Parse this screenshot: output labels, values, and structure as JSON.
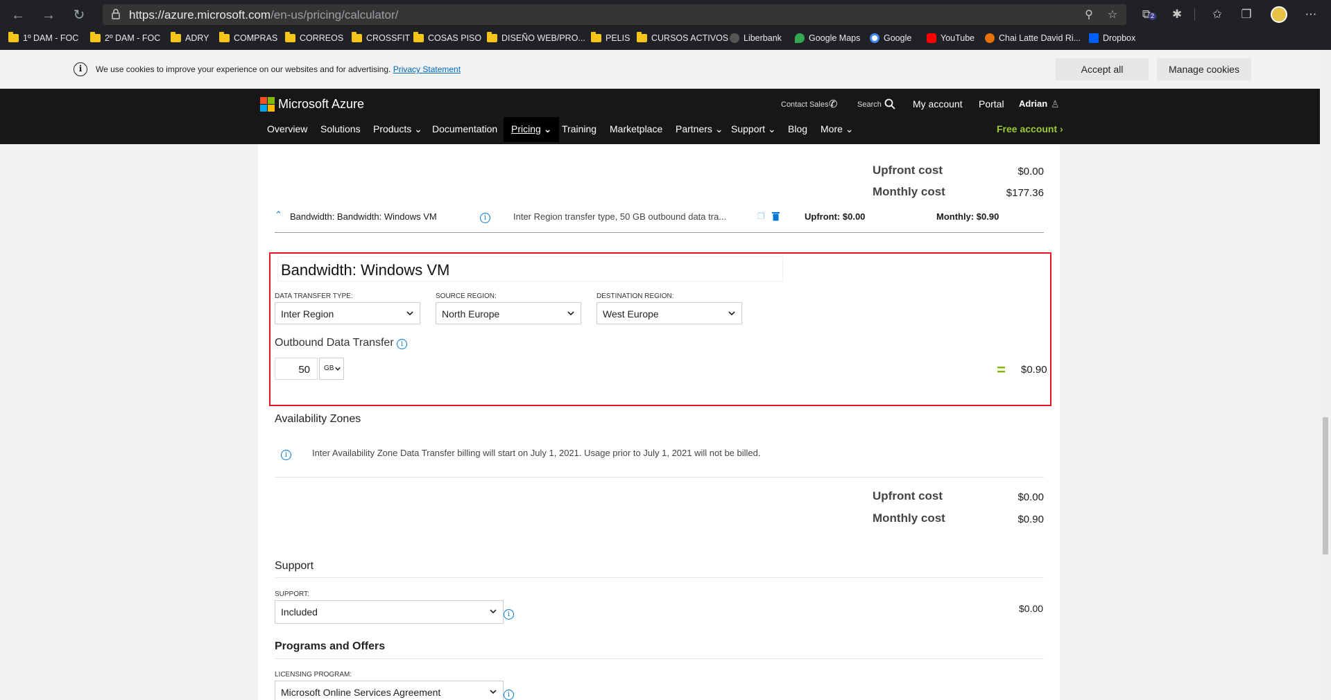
{
  "browser": {
    "url_host": "https://azure.microsoft.com",
    "url_path": "/en-us/pricing/calculator/",
    "bookmarks": [
      {
        "label": "1º DAM - FOC",
        "type": "folder"
      },
      {
        "label": "2º DAM - FOC",
        "type": "folder"
      },
      {
        "label": "ADRY",
        "type": "folder"
      },
      {
        "label": "COMPRAS",
        "type": "folder"
      },
      {
        "label": "CORREOS",
        "type": "folder"
      },
      {
        "label": "CROSSFIT",
        "type": "folder"
      },
      {
        "label": "COSAS PISO",
        "type": "folder"
      },
      {
        "label": "DISEÑO WEB/PRO...",
        "type": "folder"
      },
      {
        "label": "PELIS",
        "type": "folder"
      },
      {
        "label": "CURSOS ACTIVOS",
        "type": "folder"
      },
      {
        "label": "Liberbank",
        "type": "site"
      },
      {
        "label": "Google Maps",
        "type": "site"
      },
      {
        "label": "Google",
        "type": "site"
      },
      {
        "label": "YouTube",
        "type": "site"
      },
      {
        "label": "Chai Latte David Ri...",
        "type": "site"
      },
      {
        "label": "Dropbox",
        "type": "site"
      }
    ],
    "extension_badge": "2"
  },
  "cookie_bar": {
    "text": "We use cookies to improve your experience on our websites and for advertising.",
    "link": "Privacy Statement",
    "accept_label": "Accept all",
    "manage_label": "Manage cookies"
  },
  "header": {
    "brand": "Microsoft Azure",
    "contact_sales": "Contact Sales",
    "search": "Search",
    "my_account": "My account",
    "portal": "Portal",
    "user": "Adrian",
    "menu": [
      "Overview",
      "Solutions",
      "Products",
      "Documentation",
      "Pricing",
      "Training",
      "Marketplace",
      "Partners",
      "Support",
      "Blog",
      "More"
    ],
    "free_account": "Free account"
  },
  "summary_top": {
    "upfront_label": "Upfront cost",
    "upfront_value": "$0.00",
    "monthly_label": "Monthly cost",
    "monthly_value": "$177.36"
  },
  "item": {
    "name": "Bandwidth: Bandwidth: Windows VM",
    "description": "Inter Region transfer type, 50 GB outbound data tra...",
    "upfront": "Upfront: $0.00",
    "monthly": "Monthly: $0.90"
  },
  "config": {
    "title": "Bandwidth: Windows VM",
    "transfer_type_label": "DATA TRANSFER TYPE:",
    "transfer_type_value": "Inter Region",
    "source_region_label": "SOURCE REGION:",
    "source_region_value": "North Europe",
    "dest_region_label": "DESTINATION REGION:",
    "dest_region_value": "West Europe",
    "outbound_title": "Outbound Data Transfer",
    "outbound_qty": "50",
    "outbound_unit": "GB",
    "equals": "=",
    "outbound_price": "$0.90"
  },
  "availability": {
    "title": "Availability Zones",
    "notice": "Inter Availability Zone Data Transfer billing will start on July 1, 2021. Usage prior to July 1, 2021 will not be billed."
  },
  "summary_bottom": {
    "upfront_label": "Upfront cost",
    "upfront_value": "$0.00",
    "monthly_label": "Monthly cost",
    "monthly_value": "$0.90"
  },
  "support": {
    "title": "Support",
    "label": "SUPPORT:",
    "value": "Included",
    "price": "$0.00"
  },
  "programs": {
    "title": "Programs and Offers",
    "label": "LICENSING PROGRAM:",
    "value": "Microsoft Online Services Agreement"
  },
  "colors": {
    "accent": "#0078d4",
    "highlight_border": "#e81123",
    "free_account": "#9bcb37"
  }
}
